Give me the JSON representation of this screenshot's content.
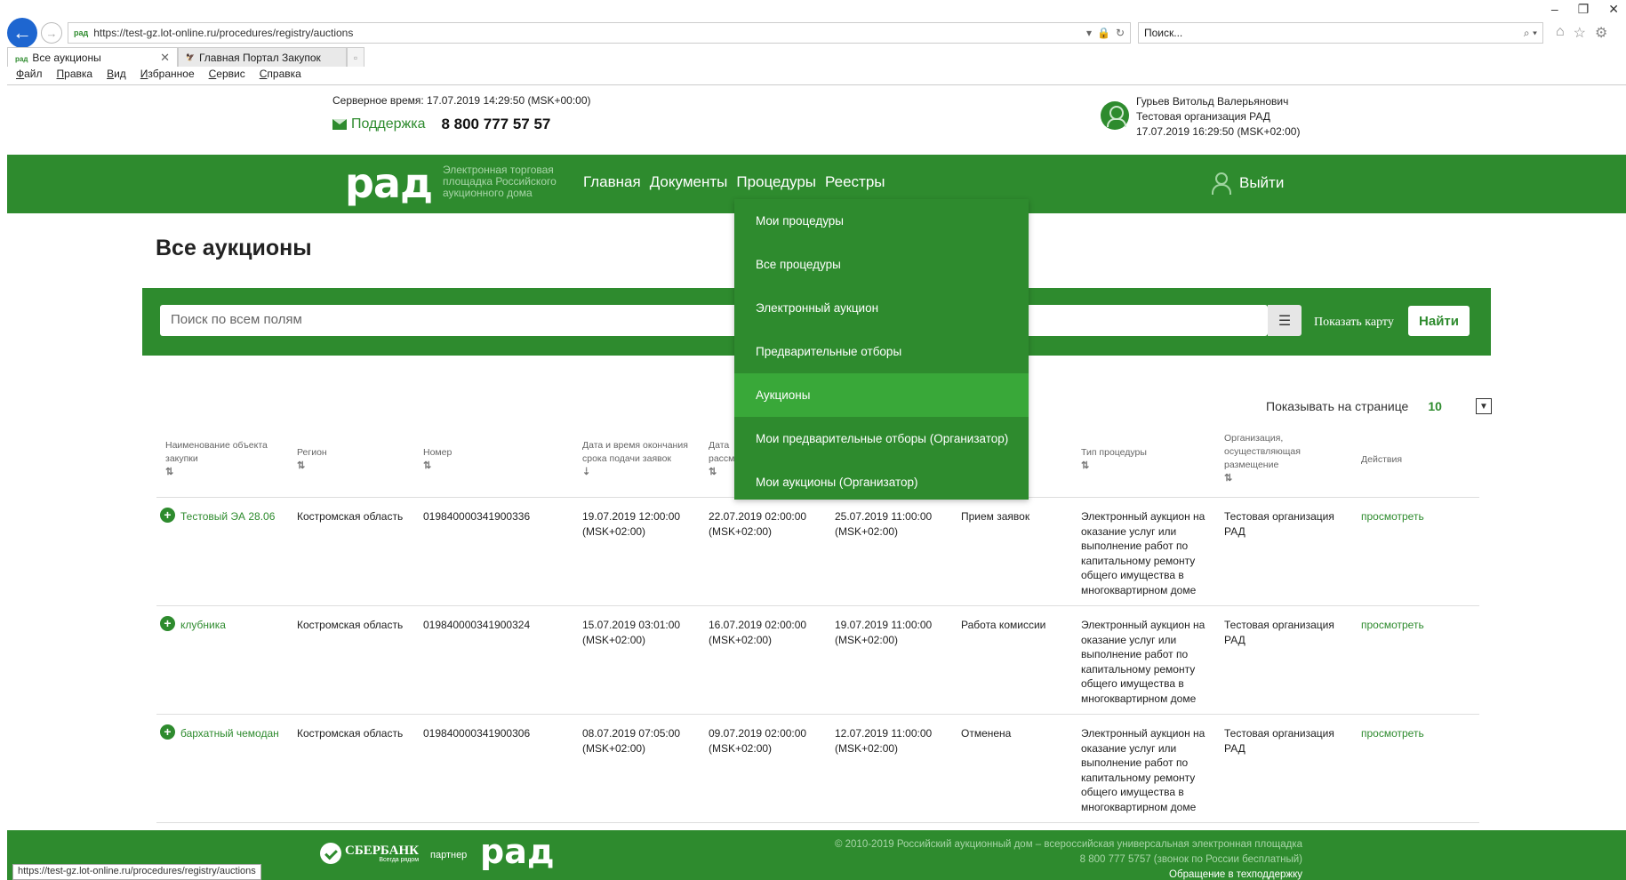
{
  "browser": {
    "url": "https://test-gz.lot-online.ru/procedures/registry/auctions",
    "url_favicon": "рад",
    "search_placeholder": "Поиск...",
    "tabs": [
      {
        "label": "Все аукционы",
        "favicon": "рад"
      },
      {
        "label": "Главная Портал Закупок",
        "favicon": "🦅"
      }
    ],
    "menu": [
      "Файл",
      "Правка",
      "Вид",
      "Избранное",
      "Сервис",
      "Справка"
    ],
    "status_url": "https://test-gz.lot-online.ru/procedures/registry/auctions"
  },
  "top": {
    "server_time": "Серверное время: 17.07.2019 14:29:50 (MSK+00:00)",
    "support_label": "Поддержка",
    "phone": "8 800 777 57 57",
    "user_name": "Гурьев Витольд Валерьянович",
    "user_org": "Тестовая организация РАД",
    "user_time": "17.07.2019 16:29:50 (MSK+02:00)"
  },
  "header": {
    "logo": "рад",
    "logo_sub": "Электронная торговая площадка Российского аукционного дома",
    "nav": [
      "Главная",
      "Документы",
      "Процедуры",
      "Реестры"
    ],
    "logout": "Выйти"
  },
  "page": {
    "title": "Все аукционы",
    "search_placeholder": "Поиск по всем полям",
    "show_map": "Показать карту",
    "find": "Найти",
    "per_page_label": "Показывать на странице",
    "per_page_value": "10"
  },
  "dropdown": {
    "items": [
      "Мои процедуры",
      "Все процедуры",
      "Электронный аукцион",
      "Предварительные отборы",
      "Аукционы",
      "Мои предварительные отборы (Организатор)",
      "Мои аукционы (Организатор)"
    ],
    "active_index": 4
  },
  "table": {
    "headers": [
      "Наименование объекта закупки",
      "Регион",
      "Номер",
      "Дата и время окончания срока подачи заявок",
      "Дата рассм",
      "Тип процедуры",
      "Организация, осуществляющая размещение",
      "Действия"
    ],
    "rows": [
      {
        "name": "Тестовый ЭА 28.06",
        "region": "Костромская область",
        "number": "019840000341900336",
        "deadline": "19.07.2019 12:00:00 (MSK+02:00)",
        "review": "22.07.2019 02:00:00 (MSK+02:00)",
        "auction": "25.07.2019 11:00:00 (MSK+02:00)",
        "status": "Прием заявок",
        "type": "Электронный аукцион на оказание услуг или выполнение работ по капитальному ремонту общего имущества в многоквартирном доме",
        "org": "Тестовая организация РАД",
        "action": "просмотреть"
      },
      {
        "name": "клубника",
        "region": "Костромская область",
        "number": "019840000341900324",
        "deadline": "15.07.2019 03:01:00 (MSK+02:00)",
        "review": "16.07.2019 02:00:00 (MSK+02:00)",
        "auction": "19.07.2019 11:00:00 (MSK+02:00)",
        "status": "Работа комиссии",
        "type": "Электронный аукцион на оказание услуг или выполнение работ по капитальному ремонту общего имущества в многоквартирном доме",
        "org": "Тестовая организация РАД",
        "action": "просмотреть"
      },
      {
        "name": "бархатный чемодан",
        "region": "Костромская область",
        "number": "019840000341900306",
        "deadline": "08.07.2019 07:05:00 (MSK+02:00)",
        "review": "09.07.2019 02:00:00 (MSK+02:00)",
        "auction": "12.07.2019 11:00:00 (MSK+02:00)",
        "status": "Отменена",
        "type": "Электронный аукцион на оказание услуг или выполнение работ по капитальному ремонту общего имущества в многоквартирном доме",
        "org": "Тестовая организация РАД",
        "action": "просмотреть"
      }
    ]
  },
  "footer": {
    "sber_name": "СБЕРБАНК",
    "sber_slogan": "Всегда рядом",
    "partner": "партнер",
    "logo": "рад",
    "copyright": "© 2010-2019 Российский аукционный дом – всероссийская универсальная электронная площадка",
    "hotline": "8 800 777 5757 (звонок по России бесплатный)",
    "support_link": "Обращение в техподдержку"
  },
  "colors": {
    "brand_green": "#2e8b2e",
    "active_item": "#39a839",
    "browser_back": "#1e66d0"
  }
}
